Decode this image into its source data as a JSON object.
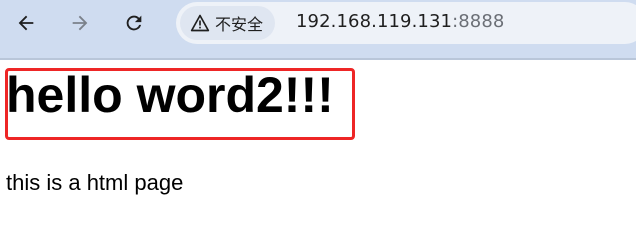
{
  "browser": {
    "nav": {
      "back_icon": "arrow-left-icon",
      "forward_icon": "arrow-right-icon",
      "reload_icon": "reload-icon"
    },
    "security_chip": {
      "icon": "warning-triangle-icon",
      "label": "不安全"
    },
    "address": {
      "host": "192.168.119.131",
      "port": ":8888"
    },
    "colors": {
      "toolbar_bg": "#cfdcf0",
      "omnibox_bg": "#eef2f8",
      "highlight_border": "#ee2626"
    }
  },
  "page": {
    "heading": "hello word2!!!",
    "paragraph": "this is a html page"
  }
}
